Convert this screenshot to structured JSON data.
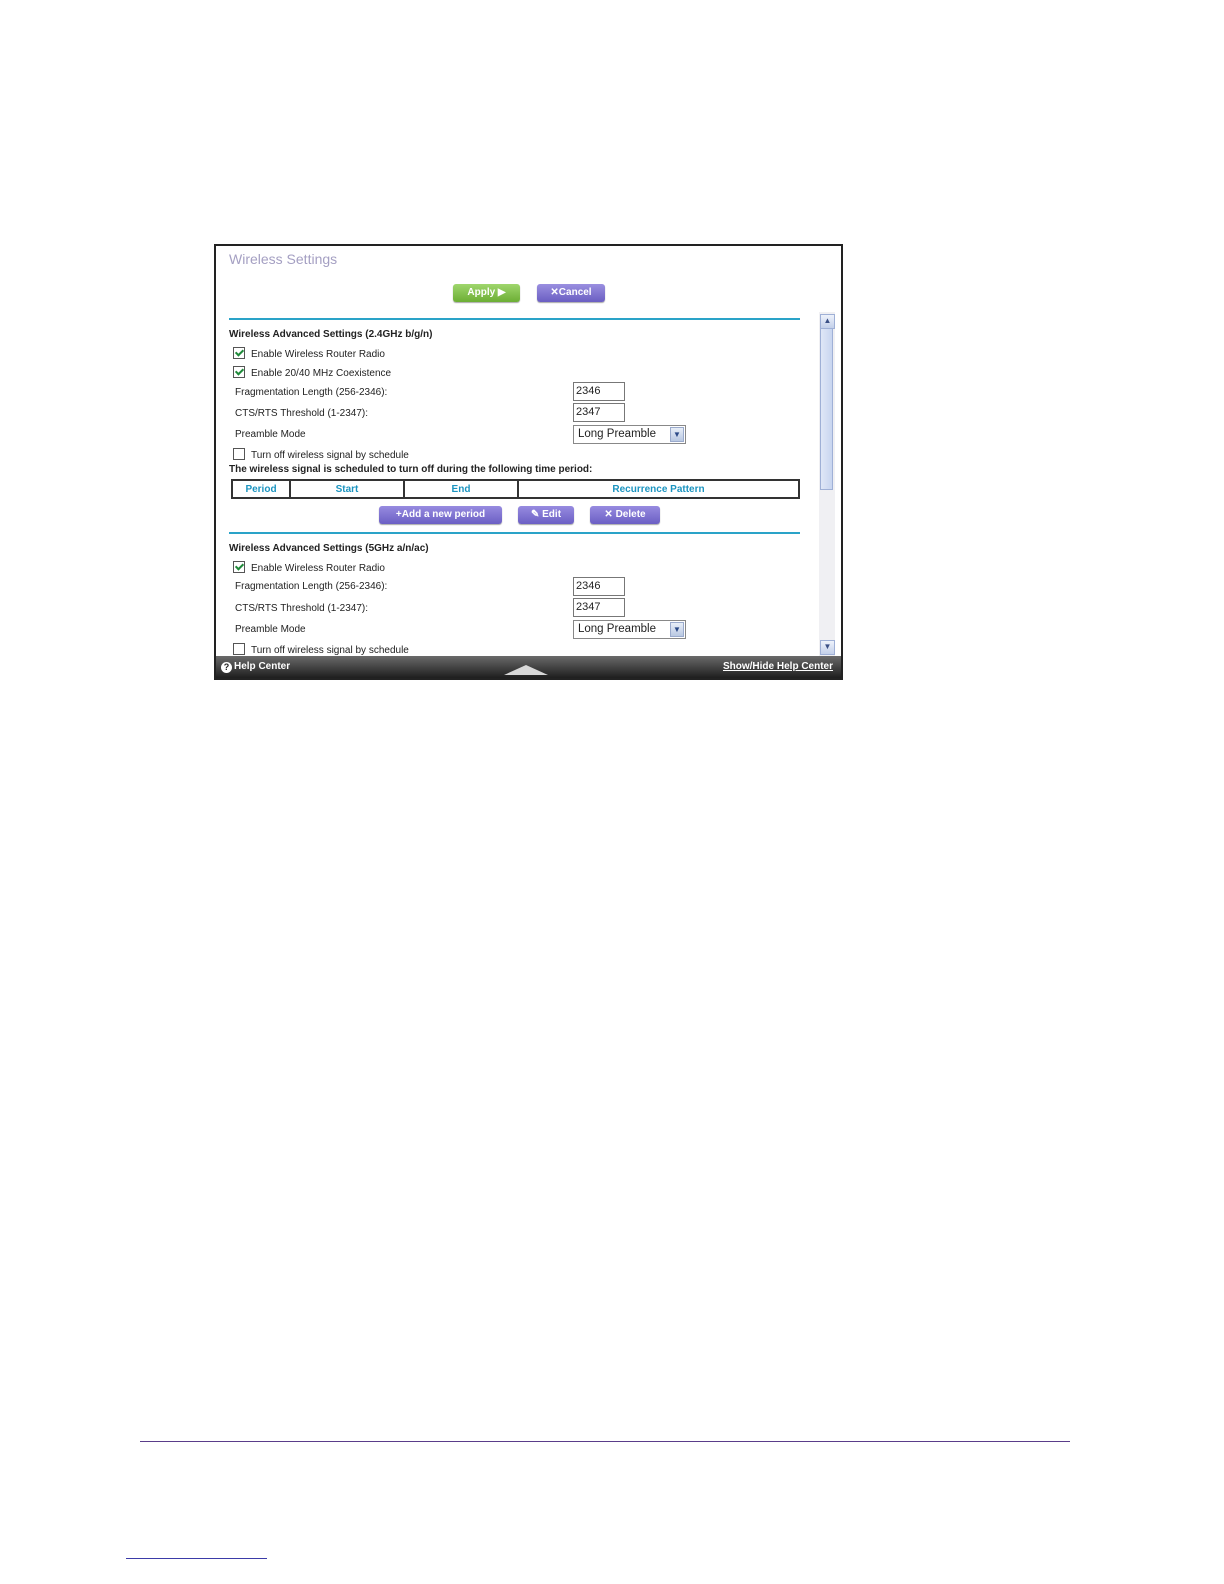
{
  "page_title": "Wireless Settings",
  "toolbar": {
    "apply_label": "Apply ▶",
    "cancel_label": "Cancel",
    "cancel_icon": "✕"
  },
  "section_24": {
    "title": "Wireless Advanced Settings (2.4GHz b/g/n)",
    "enable_radio": {
      "label": "Enable Wireless Router Radio",
      "checked": true
    },
    "coexistence": {
      "label": "Enable 20/40 MHz Coexistence",
      "checked": true
    },
    "frag_label": "Fragmentation Length (256-2346):",
    "frag_value": "2346",
    "cts_label": "CTS/RTS Threshold (1-2347):",
    "cts_value": "2347",
    "preamble_label": "Preamble Mode",
    "preamble_value": "Long Preamble",
    "schedule": {
      "label": "Turn off wireless signal by schedule",
      "checked": false
    },
    "schedule_note": "The wireless signal is scheduled to turn off during the following time period:",
    "table_headers": [
      "Period",
      "Start",
      "End",
      "Recurrence Pattern"
    ],
    "add_label": "Add a new period",
    "edit_label": "Edit",
    "delete_label": "Delete"
  },
  "section_5": {
    "title": "Wireless Advanced Settings (5GHz a/n/ac)",
    "enable_radio": {
      "label": "Enable Wireless Router Radio",
      "checked": true
    },
    "frag_label": "Fragmentation Length (256-2346):",
    "frag_value": "2346",
    "cts_label": "CTS/RTS Threshold (1-2347):",
    "cts_value": "2347",
    "preamble_label": "Preamble Mode",
    "preamble_value": "Long Preamble",
    "schedule": {
      "label": "Turn off wireless signal by schedule",
      "checked": false
    }
  },
  "bottom_bar": {
    "help_label": "Help Center",
    "toggle_label": "Show/Hide Help Center"
  },
  "colors": {
    "accent_line": "#2aa3c8",
    "apply_green": "#7dbd45",
    "button_purple": "#7a6ed0",
    "title_lavender": "#a49fc2"
  }
}
